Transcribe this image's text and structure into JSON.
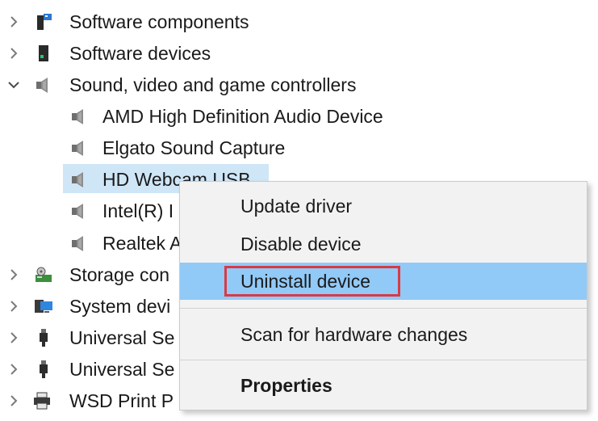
{
  "device_tree": {
    "rows": [
      {
        "label": "Software components",
        "icon": "software-components-icon",
        "expanded": false
      },
      {
        "label": "Software devices",
        "icon": "software-devices-icon",
        "expanded": false
      },
      {
        "label": "Sound, video and game controllers",
        "icon": "sound-controller-icon",
        "expanded": true
      },
      {
        "label": "AMD High Definition Audio Device",
        "icon": "speaker-icon"
      },
      {
        "label": "Elgato Sound Capture",
        "icon": "speaker-icon"
      },
      {
        "label": "HD Webcam USB",
        "icon": "speaker-icon",
        "selected": true
      },
      {
        "label": "Intel(R) I",
        "icon": "speaker-icon"
      },
      {
        "label": "Realtek A",
        "icon": "speaker-icon"
      },
      {
        "label": "Storage con",
        "icon": "storage-controller-icon",
        "expanded": false
      },
      {
        "label": "System devi",
        "icon": "system-devices-icon",
        "expanded": false
      },
      {
        "label": "Universal Se",
        "icon": "usb-icon",
        "expanded": false
      },
      {
        "label": "Universal Se",
        "icon": "usb-icon",
        "expanded": false
      },
      {
        "label": "WSD Print P",
        "icon": "printer-icon",
        "expanded": false
      }
    ]
  },
  "context_menu": {
    "items": [
      {
        "label": "Update driver"
      },
      {
        "label": "Disable device"
      },
      {
        "label": "Uninstall device",
        "hovered": true,
        "highlighted_box": true
      },
      {
        "label": "Scan for hardware changes"
      },
      {
        "label": "Properties",
        "bold": true
      }
    ]
  },
  "colors": {
    "selection": "#cfe6f7",
    "menu_background": "#f2f2f2",
    "menu_hover": "#91c9f7",
    "highlight_box": "#d93a44"
  }
}
